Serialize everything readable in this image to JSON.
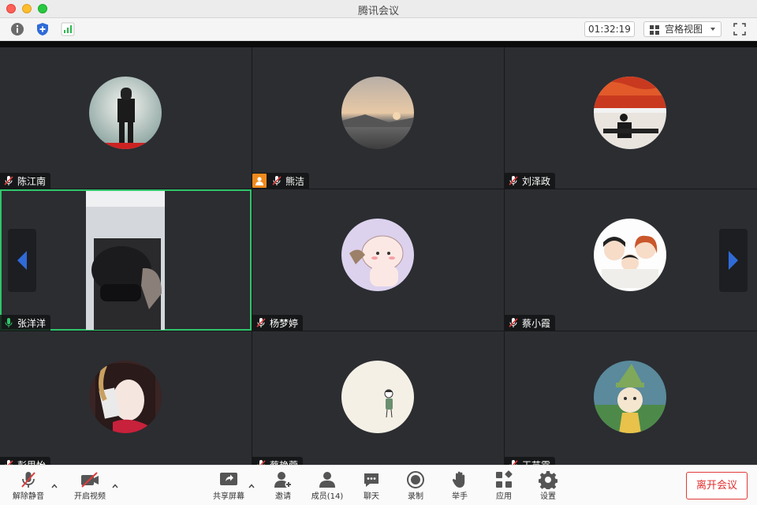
{
  "window": {
    "title": "腾讯会议"
  },
  "toolbar": {
    "timer": "01:32:19",
    "view_mode": "宫格视图"
  },
  "participants": [
    {
      "name": "陈江南",
      "mic": "muted"
    },
    {
      "name": "熊洁",
      "mic": "muted",
      "host": true
    },
    {
      "name": "刘泽政",
      "mic": "muted"
    },
    {
      "name": "张洋洋",
      "mic": "speaking",
      "video": true
    },
    {
      "name": "杨梦婷",
      "mic": "muted"
    },
    {
      "name": "蔡小霞",
      "mic": "muted"
    },
    {
      "name": "彭思怡",
      "mic": "muted"
    },
    {
      "name": "蔡艳蓉",
      "mic": "muted"
    },
    {
      "name": "王芸霞",
      "mic": "muted"
    }
  ],
  "bottom_bar": {
    "unmute": "解除静音",
    "start_video": "开启视频",
    "share_screen": "共享屏幕",
    "invite": "邀请",
    "members": "成员(14)",
    "chat": "聊天",
    "record": "录制",
    "raise_hand": "举手",
    "apps": "应用",
    "settings": "设置",
    "leave": "离开会议"
  },
  "colors": {
    "speaking_border": "#2fc66b",
    "leave_red": "#e02f2f",
    "nav_arrow": "#2f6bd8",
    "mute_red": "#e03b3b"
  }
}
